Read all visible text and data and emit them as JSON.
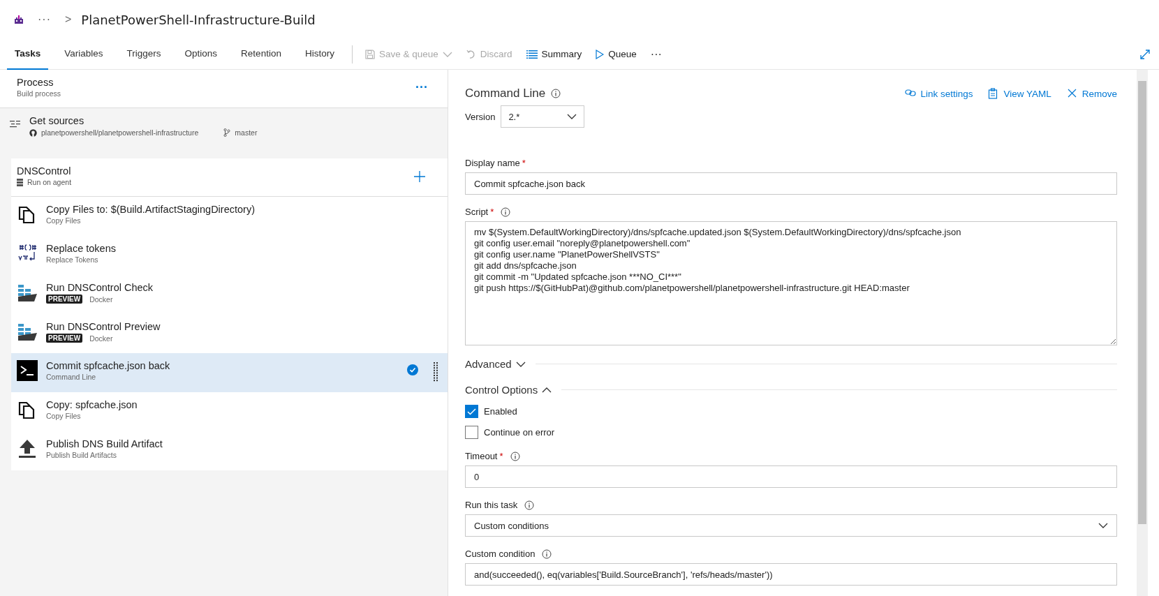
{
  "breadcrumb": {
    "ellipsis": "···",
    "separator": ">",
    "title": "PlanetPowerShell-Infrastructure-Build"
  },
  "tabs": [
    {
      "label": "Tasks",
      "selected": true
    },
    {
      "label": "Variables",
      "selected": false
    },
    {
      "label": "Triggers",
      "selected": false
    },
    {
      "label": "Options",
      "selected": false
    },
    {
      "label": "Retention",
      "selected": false
    },
    {
      "label": "History",
      "selected": false
    }
  ],
  "toolbar": [
    {
      "kind": "save",
      "label": "Save & queue",
      "disabled": true
    },
    {
      "kind": "discard",
      "label": "Discard",
      "disabled": true
    },
    {
      "kind": "summary",
      "label": "Summary",
      "disabled": false
    },
    {
      "kind": "queue",
      "label": "Queue",
      "disabled": false
    },
    {
      "kind": "more",
      "label": "···",
      "disabled": false
    }
  ],
  "process": {
    "title": "Process",
    "subtitle": "Build process",
    "more": "···"
  },
  "get_sources": {
    "title": "Get sources",
    "repo": "planetpowershell/planetpowershell-infrastructure",
    "branch": "master"
  },
  "phase": {
    "title": "DNSControl",
    "subtitle": "Run on agent"
  },
  "tasks": [
    {
      "kind": "copy",
      "title": "Copy Files to: $(Build.ArtifactStagingDirectory)",
      "subtitle": "Copy Files",
      "selected": false
    },
    {
      "kind": "replace",
      "title": "Replace tokens",
      "subtitle": "Replace Tokens",
      "selected": false
    },
    {
      "kind": "docker",
      "title": "Run DNSControl Check",
      "badge": "PREVIEW",
      "subtitle": "Docker",
      "selected": false
    },
    {
      "kind": "docker",
      "title": "Run DNSControl Preview",
      "badge": "PREVIEW",
      "subtitle": "Docker",
      "selected": false
    },
    {
      "kind": "cmd",
      "title": "Commit spfcache.json back",
      "subtitle": "Command Line",
      "selected": true
    },
    {
      "kind": "copy",
      "title": "Copy: spfcache.json",
      "subtitle": "Copy Files",
      "selected": false
    },
    {
      "kind": "publish",
      "title": "Publish DNS Build Artifact",
      "subtitle": "Publish Build Artifacts",
      "selected": false
    }
  ],
  "editor": {
    "title": "Command Line",
    "actions": [
      {
        "kind": "link",
        "label": "Link settings"
      },
      {
        "kind": "yaml",
        "label": "View YAML"
      },
      {
        "kind": "remove",
        "label": "Remove"
      }
    ],
    "version": {
      "label": "Version",
      "value": "2.*"
    },
    "form": [
      {
        "kind": "text",
        "label": "Display name",
        "required": "*",
        "info": false,
        "value": "Commit spfcache.json back"
      },
      {
        "kind": "textarea",
        "label": "Script",
        "required": "*",
        "info": true,
        "value": "mv $(System.DefaultWorkingDirectory)/dns/spfcache.updated.json $(System.DefaultWorkingDirectory)/dns/spfcache.json\ngit config user.email \"noreply@planetpowershell.com\"\ngit config user.name \"PlanetPowerShellVSTS\"\ngit add dns/spfcache.json\ngit commit -m \"Updated spfcache.json ***NO_CI***\"\ngit push https://$(GitHubPat)@github.com/planetpowershell/planetpowershell-infrastructure.git HEAD:master"
      },
      {
        "kind": "section",
        "label": "Advanced",
        "expanded": false
      },
      {
        "kind": "section",
        "label": "Control Options",
        "expanded": true
      },
      {
        "kind": "checkbox",
        "label": "Enabled",
        "checked": true
      },
      {
        "kind": "checkbox",
        "label": "Continue on error",
        "checked": false
      },
      {
        "kind": "text",
        "label": "Timeout",
        "required": "*",
        "info": true,
        "value": "0"
      },
      {
        "kind": "select",
        "label": "Run this task",
        "info": true,
        "value": "Custom conditions"
      },
      {
        "kind": "text",
        "label": "Custom condition",
        "info": true,
        "value": "and(succeeded(), eq(variables['Build.SourceBranch'], 'refs/heads/master'))"
      }
    ]
  }
}
